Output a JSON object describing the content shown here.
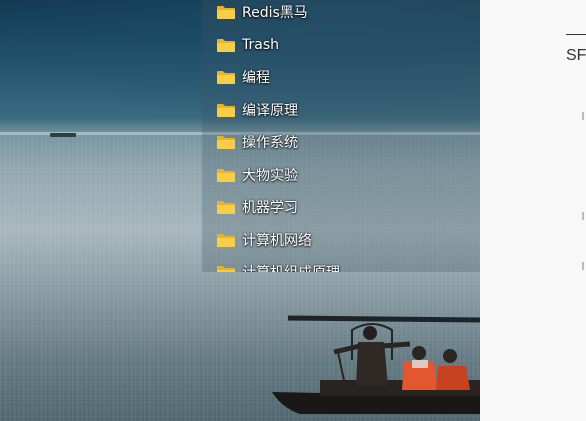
{
  "desktop": {
    "folders": [
      {
        "label": "Redis黑马",
        "icon": "folder-icon"
      },
      {
        "label": "Trash",
        "icon": "folder-icon"
      },
      {
        "label": "编程",
        "icon": "folder-icon"
      },
      {
        "label": "编译原理",
        "icon": "folder-icon"
      },
      {
        "label": "操作系统",
        "icon": "folder-icon"
      },
      {
        "label": "大物实验",
        "icon": "folder-icon"
      },
      {
        "label": "机器学习",
        "icon": "folder-icon"
      },
      {
        "label": "计算机网络",
        "icon": "folder-icon"
      },
      {
        "label": "计算机组成原理",
        "icon": "folder-icon"
      }
    ],
    "folder_color": "#f5c542"
  },
  "right_pane": {
    "heading": "SF"
  }
}
